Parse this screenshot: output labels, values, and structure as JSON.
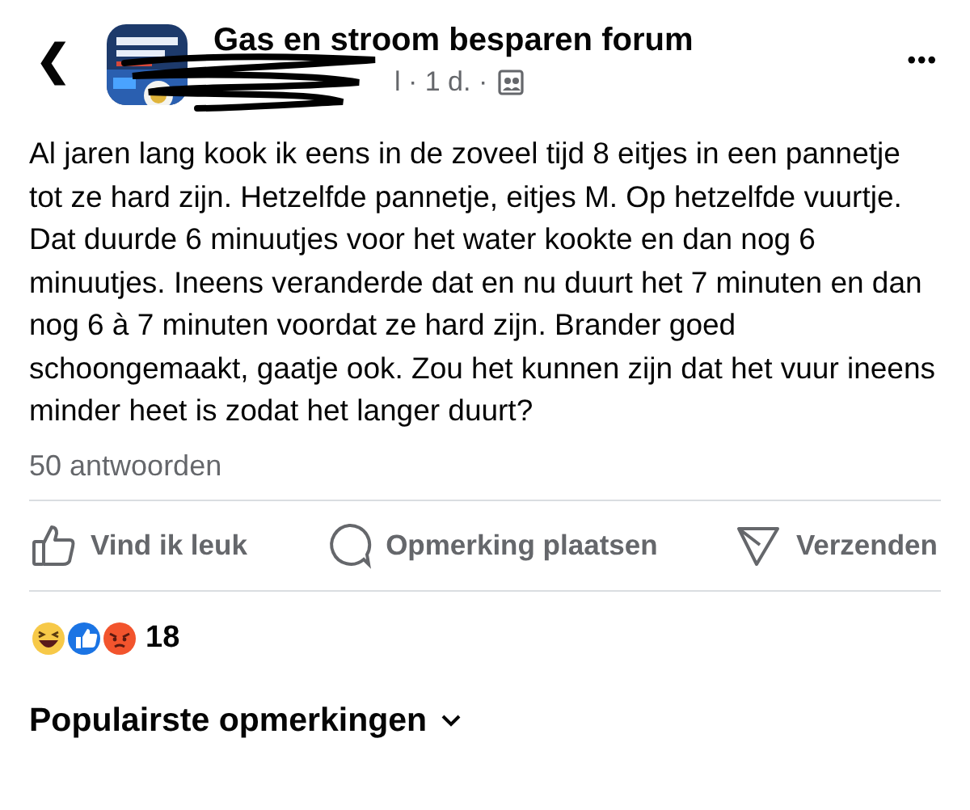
{
  "header": {
    "back": "❮",
    "group_name": "Gas en stroom besparen forum",
    "meta": "l · 1 d. ·",
    "more": "•••"
  },
  "post": {
    "text": "Al jaren lang kook ik eens in de zoveel tijd 8 eitjes in een pannetje tot ze hard zijn. Hetzelfde pannetje, eitjes M. Op hetzelfde vuurtje. Dat duurde 6 minuutjes voor het water kookte en dan nog 6 minuutjes. Ineens veranderde dat en nu duurt het 7 minuten en dan nog 6 à 7 minuten voordat ze hard zijn. Brander goed schoongemaakt, gaatje ook. Zou het kunnen zijn dat het vuur ineens minder heet is zodat het langer duurt?",
    "replies": "50 antwoorden"
  },
  "actions": [
    {
      "kind": "like",
      "label": "Vind ik leuk"
    },
    {
      "kind": "comment",
      "label": "Opmerking plaatsen"
    },
    {
      "kind": "send",
      "label": "Verzenden"
    }
  ],
  "reactions": {
    "types": [
      {
        "kind": "haha"
      },
      {
        "kind": "like"
      },
      {
        "kind": "angry"
      }
    ],
    "count": "18"
  },
  "comments_sort": {
    "label": "Populairste opmerkingen"
  }
}
